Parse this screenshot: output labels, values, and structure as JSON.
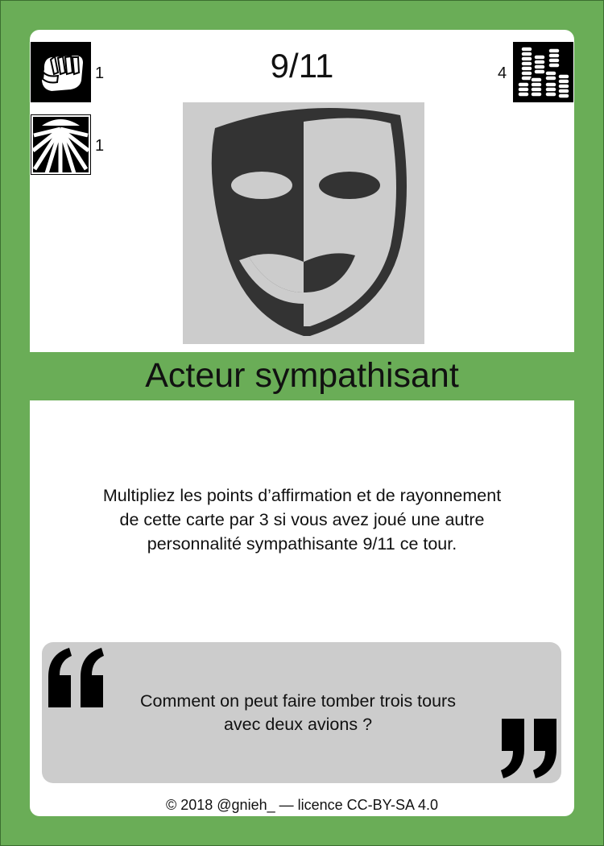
{
  "card": {
    "number": "9/11",
    "title": "Acteur sympathisant",
    "effect_lines": [
      "Multipliez les points d’affirmation et de rayonnement",
      "de cette carte par 3 si vous avez joué une autre",
      "personnalité sympathisante 9/11 ce tour."
    ],
    "quote_lines": [
      "Comment on peut faire tomber trois tours",
      "avec deux avions ?"
    ],
    "credits": "© 2018 @gnieh_ — licence CC-BY-SA 4.0",
    "illustration": "theater-mask-icon"
  },
  "stats": {
    "affirmation": {
      "icon": "fist-icon",
      "value": "1"
    },
    "rayonnement": {
      "icon": "sunburst-icon",
      "value": "1"
    },
    "cost": {
      "icon": "coins-stack-icon",
      "value": "4"
    }
  },
  "colors": {
    "frame": "#6aad57",
    "panel": "#ffffff",
    "illustration_bg": "#cccccc",
    "mask_dark": "#333333",
    "quote_bg": "#cccccc"
  }
}
